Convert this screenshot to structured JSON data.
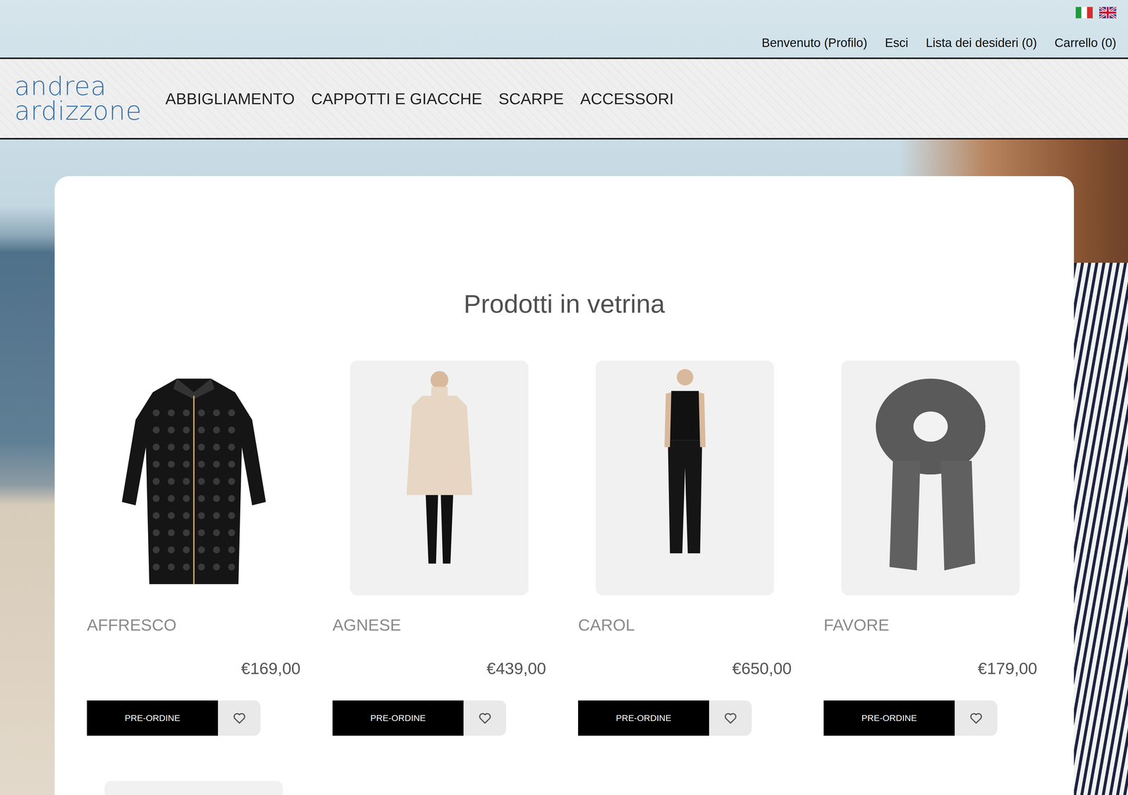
{
  "top_links": [
    "Benvenuto (Profilo)",
    "Esci",
    "Lista dei desideri (0)",
    "Carrello (0)"
  ],
  "logo": [
    "andrea",
    "ardizzone"
  ],
  "nav": [
    "ABBIGLIAMENTO",
    "CAPPOTTI E GIACCHE",
    "SCARPE",
    "ACCESSORI"
  ],
  "section_title": "Prodotti in vetrina",
  "products": [
    {
      "name": "AFFRESCO",
      "price": "€169,00",
      "button": "PRE-ORDINE"
    },
    {
      "name": "AGNESE",
      "price": "€439,00",
      "button": "PRE-ORDINE"
    },
    {
      "name": "CAROL",
      "price": "€650,00",
      "button": "PRE-ORDINE"
    },
    {
      "name": "FAVORE",
      "price": "€179,00",
      "button": "PRE-ORDINE"
    }
  ]
}
